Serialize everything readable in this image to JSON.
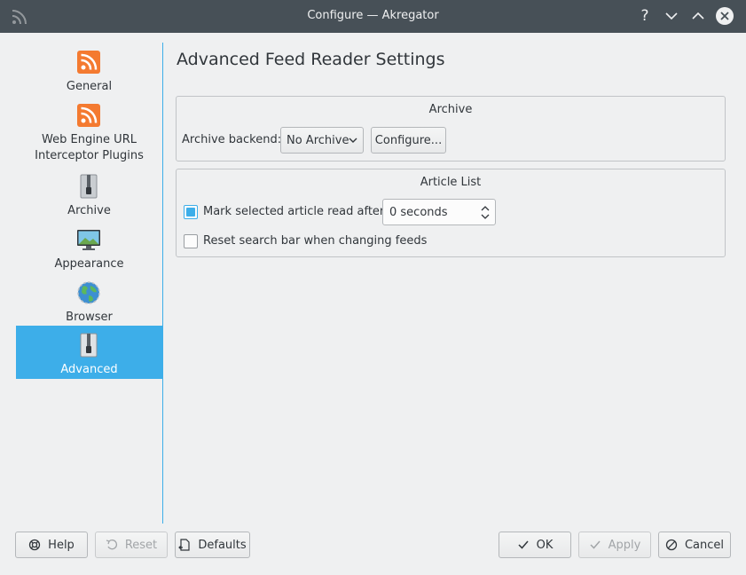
{
  "window": {
    "title": "Configure — Akregator",
    "help_glyph": "?",
    "icons": [
      "rss-icon",
      "help-icon",
      "minimize-icon",
      "maximize-icon",
      "close-icon"
    ]
  },
  "sidebar": {
    "items": [
      {
        "label": "General",
        "icon": "rss-feed-icon"
      },
      {
        "label": "Web Engine URL\nInterceptor Plugins",
        "icon": "rss-feed-icon"
      },
      {
        "label": "Archive",
        "icon": "archive-zip-icon"
      },
      {
        "label": "Appearance",
        "icon": "monitor-icon"
      },
      {
        "label": "Browser",
        "icon": "globe-icon"
      },
      {
        "label": "Advanced",
        "icon": "archive-zip-icon",
        "selected": true
      }
    ]
  },
  "main": {
    "title": "Advanced Feed Reader Settings",
    "archive": {
      "title": "Archive",
      "backend_label": "Archive backend:",
      "backend_value": "No Archive",
      "configure_label": "Configure..."
    },
    "article_list": {
      "title": "Article List",
      "mark_read_label": "Mark selected article read after",
      "mark_read_checked": true,
      "mark_read_value": "0 seconds",
      "reset_search_label": "Reset search bar when changing feeds",
      "reset_search_checked": false
    }
  },
  "footer": {
    "help": "Help",
    "reset": "Reset",
    "defaults": "Defaults",
    "ok": "OK",
    "apply": "Apply",
    "cancel": "Cancel"
  },
  "colors": {
    "accent": "#3daee9",
    "titlebar": "#475057",
    "window_bg": "#eff0f1",
    "rss_orange": "#f47a30"
  }
}
